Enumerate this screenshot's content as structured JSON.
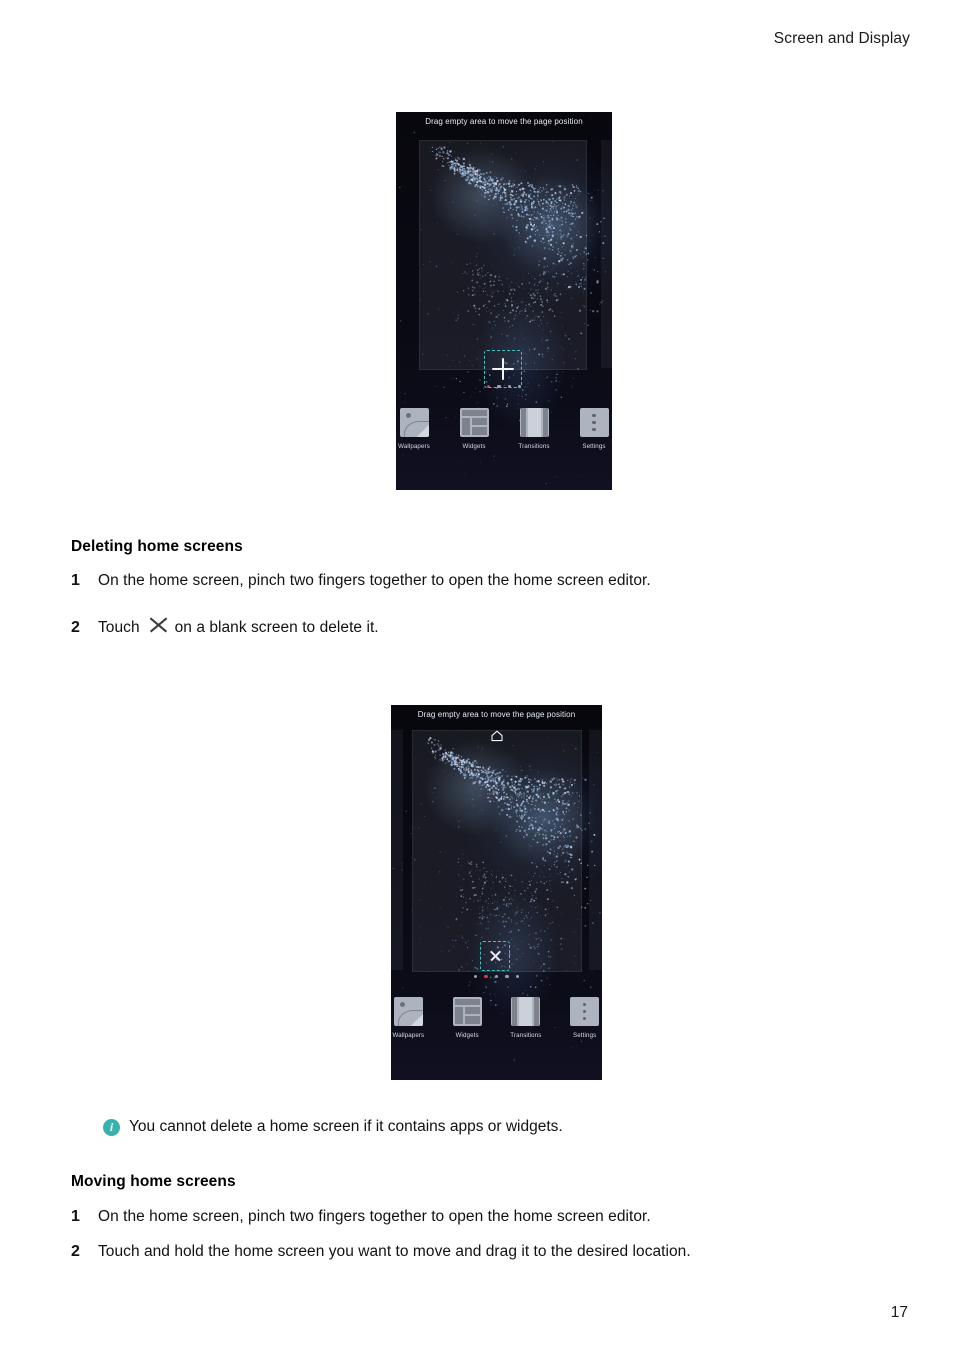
{
  "header": {
    "title": "Screen and Display"
  },
  "page_number": "17",
  "figures": {
    "add_screen": {
      "hint": "Drag empty area to move the page position",
      "center_icon": "plus-icon",
      "page_dots": {
        "count": 4,
        "active_index": 0,
        "active_color": "#e03a3a"
      },
      "toolbar": [
        {
          "label": "Wallpapers",
          "icon": "wallpapers-icon"
        },
        {
          "label": "Widgets",
          "icon": "widgets-icon"
        },
        {
          "label": "Transitions",
          "icon": "transitions-icon"
        },
        {
          "label": "Settings",
          "icon": "settings-icon"
        }
      ]
    },
    "delete_screen": {
      "hint": "Drag empty area to move the page position",
      "home_badge_icon": "home-icon",
      "center_icon": "close-icon",
      "page_dots": {
        "count": 5,
        "active_index": 1,
        "active_color": "#e03a3a"
      },
      "toolbar": [
        {
          "label": "Wallpapers",
          "icon": "wallpapers-icon"
        },
        {
          "label": "Widgets",
          "icon": "widgets-icon"
        },
        {
          "label": "Transitions",
          "icon": "transitions-icon"
        },
        {
          "label": "Settings",
          "icon": "settings-icon"
        }
      ]
    }
  },
  "sections": {
    "deleting": {
      "heading": "Deleting home screens",
      "step1_num": "1",
      "step1_text": "On the home screen, pinch two fingers together to open the home screen editor.",
      "step2_num": "2",
      "step2_prefix": "Touch",
      "step2_icon": "close-icon",
      "step2_suffix": "on a blank screen to delete it."
    },
    "note": {
      "icon": "info-icon",
      "icon_color": "#37b3ae",
      "icon_glyph": "i",
      "text": "You cannot delete a home screen if it contains apps or widgets."
    },
    "moving": {
      "heading": "Moving home screens",
      "step1_num": "1",
      "step1_text": "On the home screen, pinch two fingers together to open the home screen editor.",
      "step2_num": "2",
      "step2_text": "Touch and hold the home screen you want to move and drag it to the desired location."
    }
  }
}
